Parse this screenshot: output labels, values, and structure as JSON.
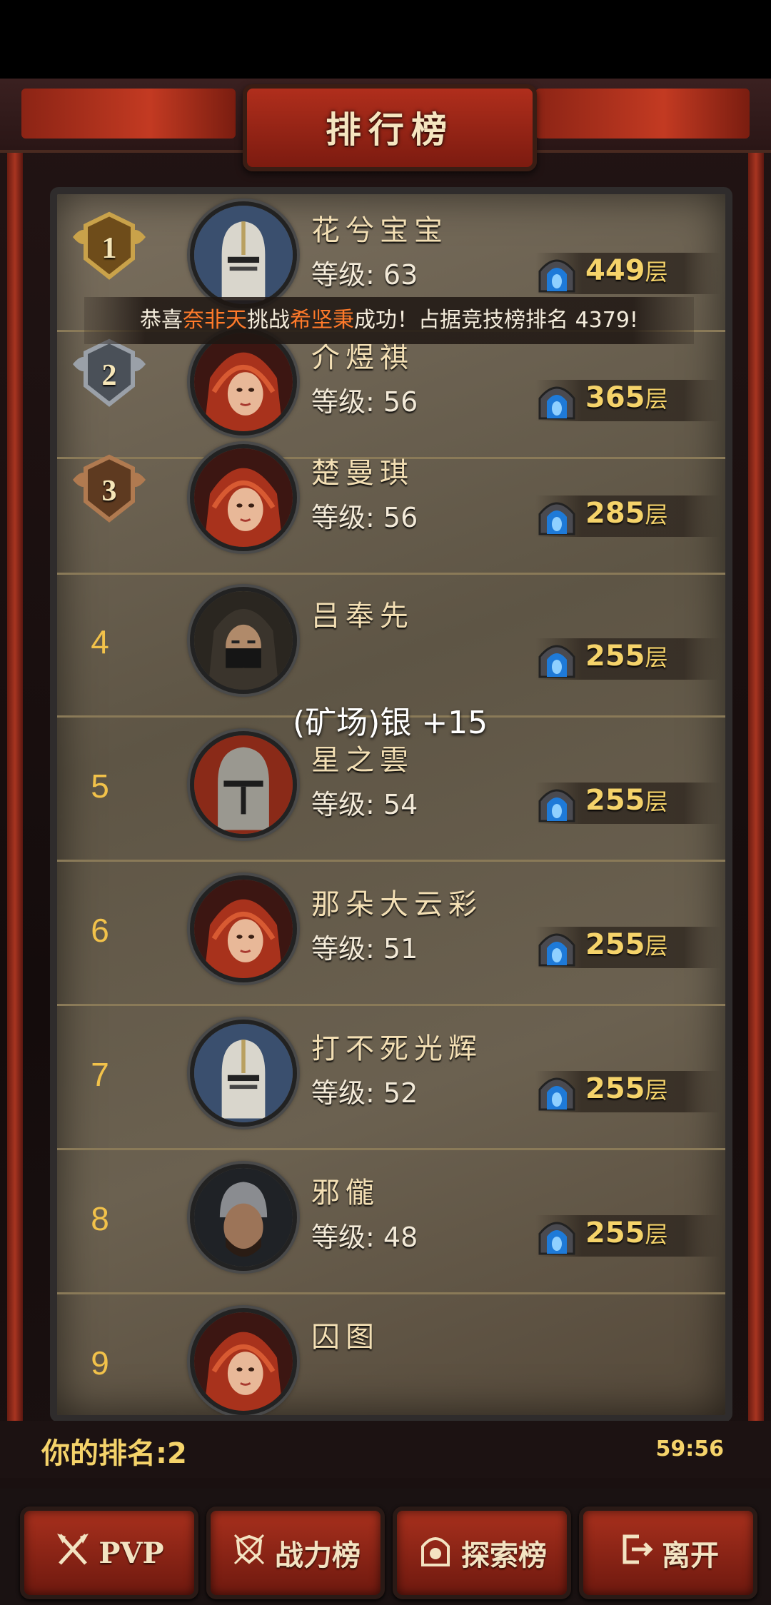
{
  "title": "排行榜",
  "notice": {
    "prefix": "恭喜",
    "player1": "奈非天",
    "middle": "挑战",
    "player2": "希坚秉",
    "suffix": "成功！占据竞技榜排名 4379!"
  },
  "level_prefix": "等级: ",
  "score_unit": "层",
  "floating_message": "(矿场)银 +15",
  "rankings": [
    {
      "rank": "1",
      "name": "花兮宝宝",
      "level": "63",
      "score": "449",
      "avatar": "knight-helmet"
    },
    {
      "rank": "2",
      "name": "介煜祺",
      "level": "56",
      "score": "365",
      "avatar": "red-hood-woman"
    },
    {
      "rank": "3",
      "name": "楚曼琪",
      "level": "56",
      "score": "285",
      "avatar": "red-hood-woman"
    },
    {
      "rank": "4",
      "name": "吕奉先",
      "level": "",
      "score": "255",
      "avatar": "masked-rogue"
    },
    {
      "rank": "5",
      "name": "星之雲",
      "level": "54",
      "score": "255",
      "avatar": "crusader-helmet"
    },
    {
      "rank": "6",
      "name": "那朵大云彩",
      "level": "51",
      "score": "255",
      "avatar": "red-hood-woman"
    },
    {
      "rank": "7",
      "name": "打不死光辉",
      "level": "52",
      "score": "255",
      "avatar": "knight-helmet"
    },
    {
      "rank": "8",
      "name": "邪儱",
      "level": "48",
      "score": "255",
      "avatar": "barbarian"
    },
    {
      "rank": "9",
      "name": "囚图",
      "level": "",
      "score": "",
      "avatar": "red-hood-woman"
    }
  ],
  "my_rank_label": "你的排名:2",
  "timer": "59:56",
  "buttons": {
    "pvp": "PVP",
    "power": "战力榜",
    "explore": "探索榜",
    "leave": "离开"
  },
  "icons": {
    "pvp": "crossed-axes-icon",
    "power": "shield-swords-icon",
    "explore": "portal-icon",
    "leave": "exit-door-icon"
  },
  "colors": {
    "gold": "#f5d36a",
    "highlight": "#ff7a2a",
    "button_red": "#a8301d"
  }
}
